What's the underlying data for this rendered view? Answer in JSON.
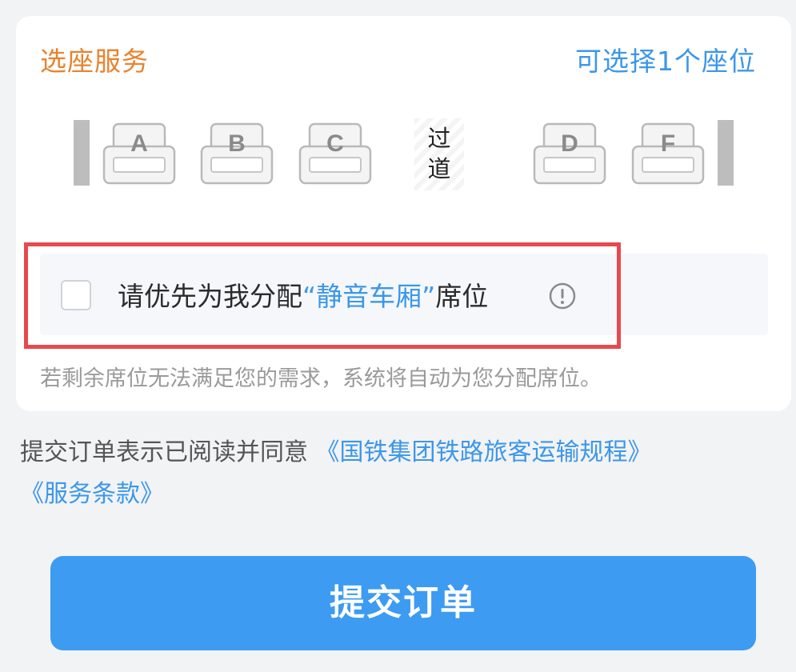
{
  "seat_service": {
    "title": "选座服务",
    "hint": "可选择1个座位",
    "seats_left": [
      "A",
      "B",
      "C"
    ],
    "seats_right": [
      "D",
      "F"
    ],
    "aisle_chars": [
      "过",
      "道"
    ]
  },
  "quiet_carriage": {
    "text_before": "请优先为我分配",
    "highlight": "“静音车厢”",
    "text_after": "席位",
    "info_icon": "info-circle-icon",
    "checked": false
  },
  "fallback_note": "若剩余席位无法满足您的需求，系统将自动为您分配席位。",
  "agreement": {
    "prefix": "提交订单表示已阅读并同意 ",
    "link1": "《国铁集团铁路旅客运输规程》",
    "link2": "《服务条款》"
  },
  "submit_button": "提交订单",
  "colors": {
    "title_orange": "#e8832c",
    "link_blue": "#3c97e8",
    "button_blue": "#3d9bf2",
    "highlight_red": "#e8494d"
  }
}
